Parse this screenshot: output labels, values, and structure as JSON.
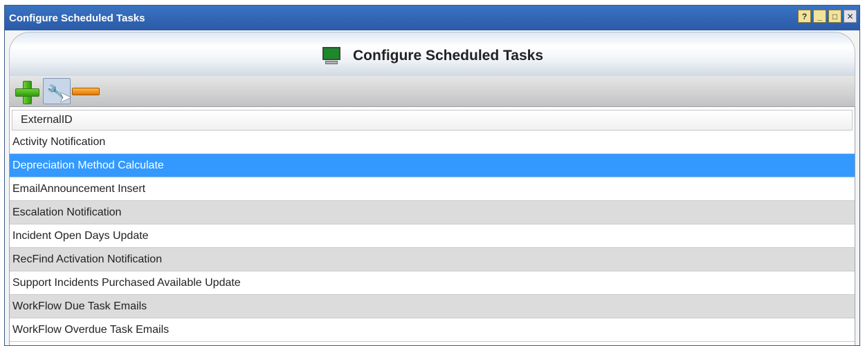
{
  "window": {
    "title": "Configure Scheduled Tasks",
    "controls": {
      "help_label": "?",
      "minimize_label": "_",
      "maximize_label": "□",
      "close_label": "✕"
    }
  },
  "header": {
    "title": "Configure Scheduled Tasks",
    "icon": "monitor-icon"
  },
  "toolbar": {
    "buttons": [
      {
        "name": "add-button",
        "icon": "plus-icon"
      },
      {
        "name": "edit-button",
        "icon": "wrench-icon"
      },
      {
        "name": "remove-button",
        "icon": "minus-icon"
      }
    ]
  },
  "grid": {
    "column_header": "ExternalID",
    "selected_index": 1,
    "rows": [
      "Activity Notification",
      "Depreciation Method Calculate",
      "EmailAnnouncement Insert",
      "Escalation Notification",
      "Incident Open Days Update",
      "RecFind Activation Notification",
      "Support Incidents Purchased Available Update",
      "WorkFlow Due Task Emails",
      "WorkFlow Overdue Task Emails"
    ]
  },
  "colors": {
    "titlebar": "#2a5aa6",
    "selection": "#3399ff",
    "alt_row": "#dcdcdc"
  }
}
